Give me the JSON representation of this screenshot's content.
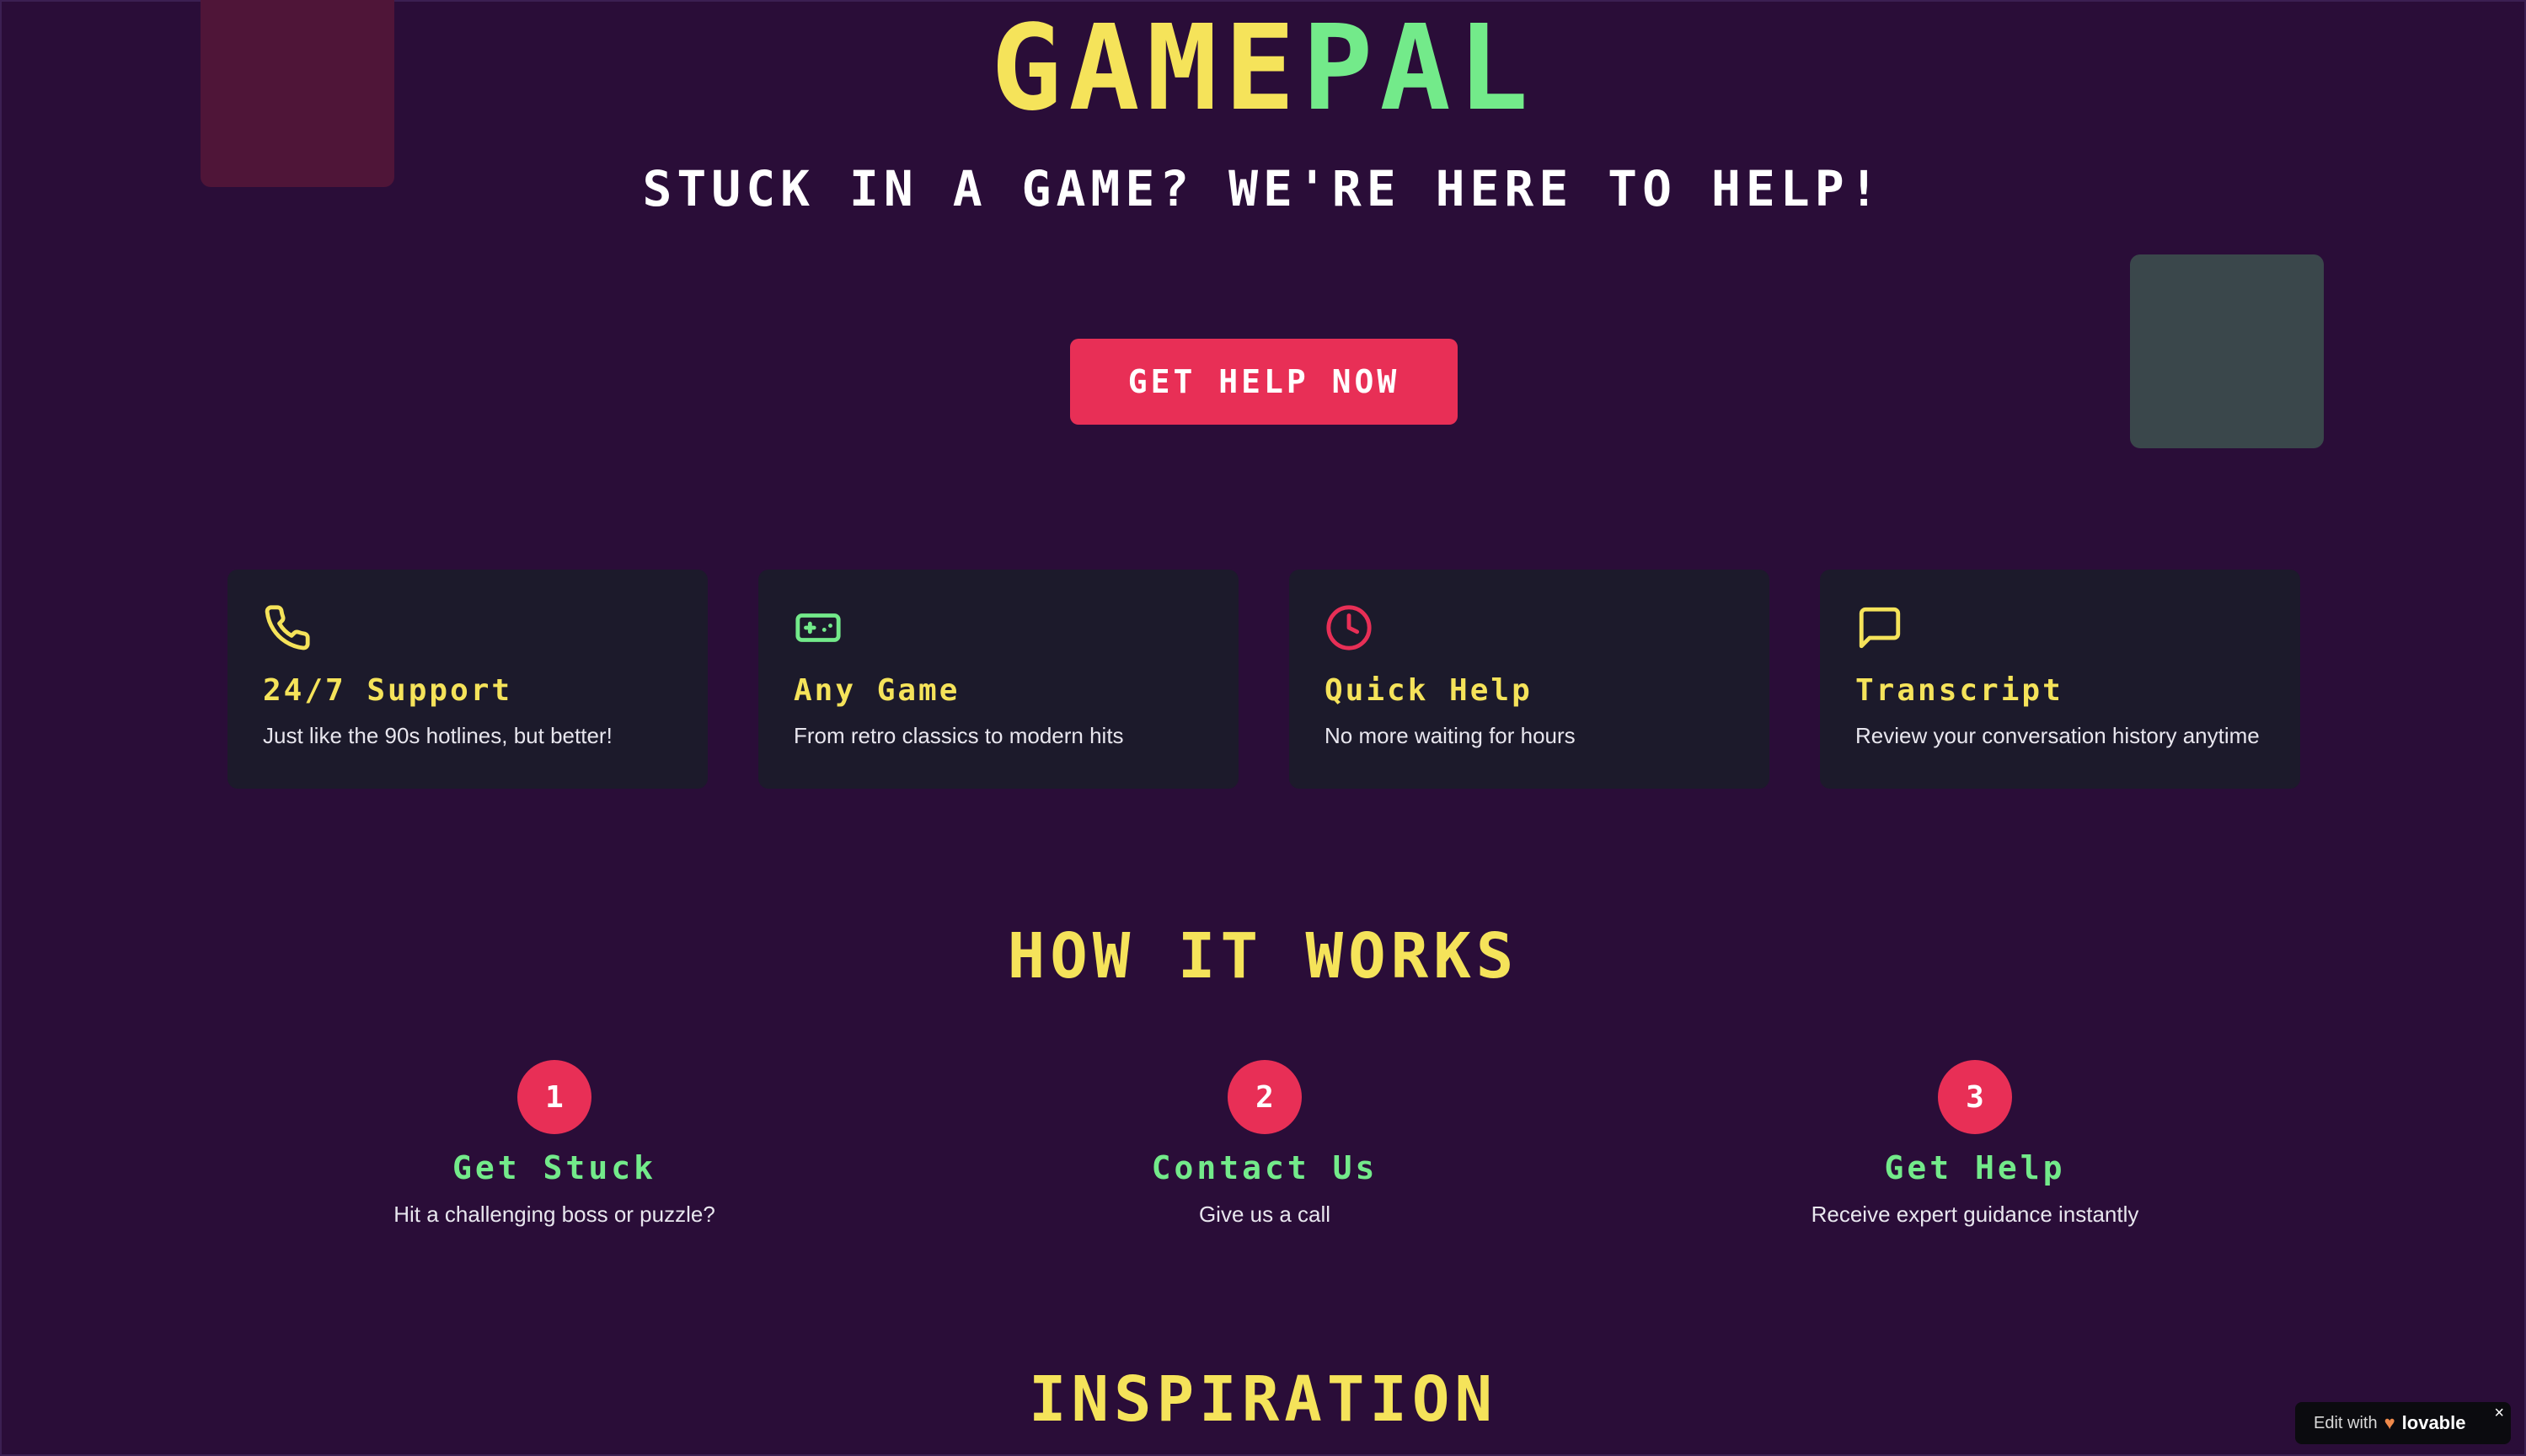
{
  "header": {
    "logo_part1": "GAME",
    "logo_part2": "PAL",
    "tagline": "STUCK IN A GAME? WE'RE HERE TO HELP!",
    "cta_label": "GET HELP NOW"
  },
  "features": [
    {
      "icon": "phone-icon",
      "title": "24/7 Support",
      "description": "Just like the 90s hotlines, but better!"
    },
    {
      "icon": "gamepad-icon",
      "title": "Any Game",
      "description": "From retro classics to modern hits"
    },
    {
      "icon": "clock-icon",
      "title": "Quick Help",
      "description": "No more waiting for hours"
    },
    {
      "icon": "message-icon",
      "title": "Transcript",
      "description": "Review your conversation history anytime"
    }
  ],
  "how_it_works": {
    "title": "HOW IT WORKS",
    "steps": [
      {
        "number": "1",
        "title": "Get Stuck",
        "description": "Hit a challenging boss or puzzle?"
      },
      {
        "number": "2",
        "title": "Contact Us",
        "description": "Give us a call"
      },
      {
        "number": "3",
        "title": "Get Help",
        "description": "Receive expert guidance instantly"
      }
    ]
  },
  "inspiration": {
    "title": "INSPIRATION"
  },
  "badge": {
    "edit_label": "Edit with",
    "brand": "lovable",
    "close": "×"
  },
  "colors": {
    "background": "#2a0d38",
    "yellow": "#f5e35a",
    "green": "#73ea8a",
    "red": "#e82f56",
    "card": "#1c1a2b"
  }
}
